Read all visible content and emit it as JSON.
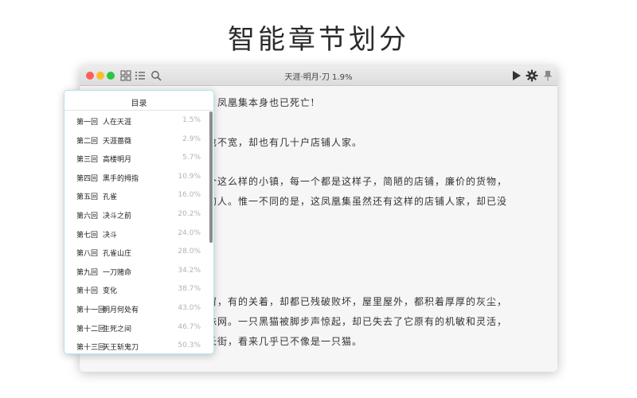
{
  "headline": "智能章节划分",
  "window": {
    "title": "天涯·明月·刀  1.9%"
  },
  "reader_lines": [
    "，凤凰集本身也已死亡!",
    "也不宽，却也有几十户店铺人家。",
    "个这么样的小镇，每一个都是这样子，简陋的店铺，廉价的货物，",
    "的人。惟一不同的是，这凤凰集虽然还有这样的店铺人家，却已没",
    "。",
    "窗，有的关着，却都已残破败坏，屋里屋外，都积着厚厚的灰尘，",
    "蛛网。一只黑猫被脚步声惊起，却已失去了它原有的机敏和灵活，",
    "长街，看来几乎已不像是一只猫。"
  ],
  "toc": {
    "title": "目录",
    "chapters": [
      {
        "num": "第一回",
        "name": "人在天涯",
        "pct": "1.5%"
      },
      {
        "num": "第二回",
        "name": "天涯蔷薇",
        "pct": "2.9%"
      },
      {
        "num": "第三回",
        "name": "高楼明月",
        "pct": "5.7%"
      },
      {
        "num": "第四回",
        "name": "黑手的拇指",
        "pct": "10.9%"
      },
      {
        "num": "第五回",
        "name": "孔雀",
        "pct": "16.0%"
      },
      {
        "num": "第六回",
        "name": "决斗之前",
        "pct": "20.2%"
      },
      {
        "num": "第七回",
        "name": "决斗",
        "pct": "24.0%"
      },
      {
        "num": "第八回",
        "name": "孔雀山庄",
        "pct": "28.0%"
      },
      {
        "num": "第九回",
        "name": "一刀赌命",
        "pct": "34.2%"
      },
      {
        "num": "第十回",
        "name": "变化",
        "pct": "38.7%"
      },
      {
        "num": "第十一回",
        "name": "明月何处有",
        "pct": "43.0%"
      },
      {
        "num": "第十二回",
        "name": "生死之间",
        "pct": "46.7%"
      },
      {
        "num": "第十三回",
        "name": "天王斩鬼刀",
        "pct": "50.3%"
      }
    ]
  },
  "icons": {
    "grid": "grid-view-icon",
    "list": "list-toc-icon",
    "search": "search-icon",
    "play": "play-icon",
    "settings": "gear-icon",
    "pin": "pin-icon"
  },
  "colors": {
    "toc_border": "#b4e3ef",
    "close": "#fc5f57",
    "minimize": "#fdbc2e",
    "maximize": "#28c840"
  }
}
